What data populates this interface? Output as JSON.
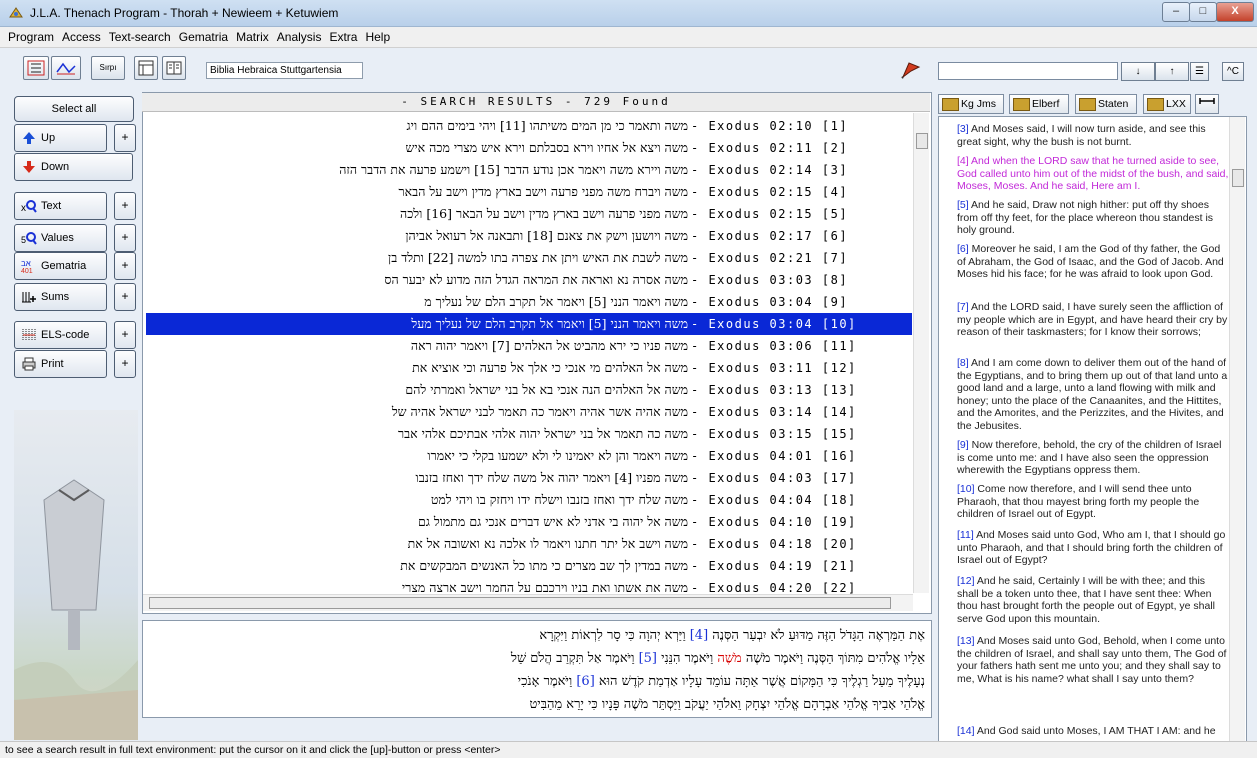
{
  "window": {
    "title": "J.L.A. Thenach Program - Thorah + Newieem + Ketuwiem",
    "minimize": "–",
    "maximize": "□",
    "close": "X"
  },
  "menu": [
    "Program",
    "Access",
    "Text-search",
    "Gematria",
    "Matrix",
    "Analysis",
    "Extra",
    "Help"
  ],
  "toolbar": {
    "bible": "Biblia Hebraica Stuttgartensia",
    "btn3": "Sırpı"
  },
  "right_toolbar": {
    "find_down": "↓",
    "find_up": "↑",
    "list_icon": "☰",
    "config": "^C"
  },
  "left": {
    "select_all": "Select all",
    "up": "Up",
    "down": "Down",
    "text": "Text",
    "values": "Values",
    "gematria": "Gematria",
    "sums": "Sums",
    "els": "ELS-code",
    "print": "Print",
    "plus": "+"
  },
  "results": {
    "title": "- SEARCH RESULTS - 729 Found",
    "rows": [
      {
        "heb": "משה ותאמר כי מן המים משיתהו [11] ויהי בימים ההם ויג",
        "ref": "- Exodus 02:10 [1]"
      },
      {
        "heb": "משה ויצא אל אחיו וירא בסבלתם וירא איש מצרי מכה איש",
        "ref": "- Exodus 02:11 [2]"
      },
      {
        "heb": "משה ויירא משה ויאמר אכן נודע הדבר [15] וישמע פרעה את הדבר הזה",
        "ref": "- Exodus 02:14 [3]"
      },
      {
        "heb": "משה ויברח משה מפני פרעה וישב בארץ מדין וישב על הבאר",
        "ref": "- Exodus 02:15 [4]"
      },
      {
        "heb": "משה מפני פרעה וישב בארץ מדין וישב על הבאר [16] ולכה",
        "ref": "- Exodus 02:15 [5]"
      },
      {
        "heb": "משה ויושען וישק את צאנם [18] ותבאנה אל רעואל אביהן",
        "ref": "- Exodus 02:17 [6]"
      },
      {
        "heb": "משה לשבת את האיש ויתן את צפרה בתו למשה [22] ותלד בן",
        "ref": "- Exodus 02:21 [7]"
      },
      {
        "heb": "משה אסרה נא ואראה את המראה הגדל הזה מדוע לא יבער הס",
        "ref": "- Exodus 03:03 [8]"
      },
      {
        "heb": "משה ויאמר הנני [5] ויאמר אל תקרב הלם של נעליך מ",
        "ref": "- Exodus 03:04 [9]"
      },
      {
        "heb": "משה ויאמר הנני [5] ויאמר אל תקרב הלם של נעליך מעל",
        "ref": "- Exodus 03:04 [10]"
      },
      {
        "heb": "משה פניו כי ירא מהביט אל האלהים [7] ויאמר יהוה ראה",
        "ref": "- Exodus 03:06 [11]"
      },
      {
        "heb": "משה אל האלהים מי אנכי כי אלך אל פרעה וכי אוציא את",
        "ref": "- Exodus 03:11 [12]"
      },
      {
        "heb": "משה אל האלהים הנה אנכי בא אל בני ישראל ואמרתי להם",
        "ref": "- Exodus 03:13 [13]"
      },
      {
        "heb": "משה אהיה אשר אהיה ויאמר כה תאמר לבני ישראל אהיה של",
        "ref": "- Exodus 03:14 [14]"
      },
      {
        "heb": "משה כה תאמר אל בני ישראל יהוה אלהי אבתיכם אלהי אבר",
        "ref": "- Exodus 03:15 [15]"
      },
      {
        "heb": "משה ויאמר והן לא יאמינו לי ולא ישמעו בקלי כי יאמרו",
        "ref": "- Exodus 04:01 [16]"
      },
      {
        "heb": "משה מפניו [4] ויאמר יהוה אל משה שלח ידך ואחז בזנבו",
        "ref": "- Exodus 04:03 [17]"
      },
      {
        "heb": "משה שלח ידך ואחז בזנבו וישלח ידו ויחזק בו ויהי למט",
        "ref": "- Exodus 04:04 [18]"
      },
      {
        "heb": "משה אל יהוה בי אדני לא איש דברים אנכי גם מתמול גם",
        "ref": "- Exodus 04:10 [19]"
      },
      {
        "heb": "משה וישב אל יתר חתנו ויאמר לו אלכה נא ואשובה אל את",
        "ref": "- Exodus 04:18 [20]"
      },
      {
        "heb": "משה במדין לך שב מצרים כי מתו כל האנשים המבקשים את",
        "ref": "- Exodus 04:19 [21]"
      },
      {
        "heb": "משה את אשתו ואת בניו וירכבם על החמר וישב ארצה מצרי",
        "ref": "- Exodus 04:20 [22]"
      }
    ]
  },
  "fulltext": {
    "line1": {
      "a": "אֶת הַמַּרְאֶה הַגָּדֹל הַזֶּה מַדּוּעַ לֹא יִבְעַר הַסְּנֶה ",
      "n": "[4]",
      "b": " וַיַּרְא יְהוָה כִּי סָר לִרְאוֹת וַיִּקְרָא"
    },
    "line2": {
      "a": "אֵלָיו אֱלֹהִים מִתּוֹךְ הַסְּנֶה וַיֹּאמֶר מֹשֶׁה ",
      "r": "מֹשֶׁה",
      "b": " וַיֹּאמֶר הִנֵּנִי ",
      "n": "[5]",
      "c": " וַיֹּאמֶר אַל תִּקְרַב הֲלֹם שַׁל"
    },
    "line3": {
      "a": "נְעָלֶיךָ מֵעַל רַגְלֶיךָ כִּי הַמָּקוֹם אֲשֶׁר אַתָּה עוֹמֵד עָלָיו אַדְמַת קֹדֶשׁ הוּא ",
      "n": "[6]",
      "b": " וַיֹּאמֶר אָנֹכִי"
    },
    "line4": {
      "a": "אֱלֹהֵי אָבִיךָ אֱלֹהֵי אַבְרָהָם אֱלֹהֵי יִצְחָק וֵאלֹהֵי יַעֲקֹב וַיַּסְתֵּר מֹשֶׁה פָּנָיו כִּי יָרֵא מֵהַבִּיט"
    }
  },
  "tabs": [
    "Kg Jms",
    "Elberf",
    "Staten",
    "LXX"
  ],
  "verses": [
    {
      "n": "[3]",
      "t": " And Moses said, I will now turn aside, and see this great sight, why the bush is not burnt."
    },
    {
      "n": "[4]",
      "t": " And when the LORD saw that he turned aside to see, God called unto him out of the midst of the bush, and said, Moses, Moses. And he said, Here am I."
    },
    {
      "n": "[5]",
      "t": " And he said, Draw not nigh hither: put off thy shoes from off thy feet, for the place whereon thou standest is holy ground."
    },
    {
      "n": "[6]",
      "t": " Moreover he said, I am the God of thy father, the God of Abraham, the God of Isaac, and the God of Jacob. And Moses hid his face; for he was afraid to look upon God."
    },
    {
      "n": "[7]",
      "t": " And the LORD said, I have surely seen the affliction of my people which are in Egypt, and have heard their cry by reason of their taskmasters; for I know their sorrows;"
    },
    {
      "n": "[8]",
      "t": " And I am come down to deliver them out of the hand of the Egyptians, and to bring them up out of that land unto a good land and a large, unto a land flowing with milk and honey; unto the place of the Canaanites, and the Hittites, and the Amorites, and the Perizzites, and the Hivites, and the Jebusites."
    },
    {
      "n": "[9]",
      "t": " Now therefore, behold, the cry of the children of Israel is come unto me: and I have also seen the oppression wherewith the Egyptians oppress them."
    },
    {
      "n": "[10]",
      "t": " Come now therefore, and I will send thee unto Pharaoh, that thou mayest bring forth my people the children of Israel out of Egypt."
    },
    {
      "n": "[11]",
      "t": " And Moses said unto God, Who am I, that I should go unto Pharaoh, and that I should bring forth the children of Israel out of Egypt?"
    },
    {
      "n": "[12]",
      "t": " And he said, Certainly I will be with thee; and this shall be a token unto thee, that I have sent thee: When thou hast brought forth the people out of Egypt, ye shall serve God upon this mountain."
    },
    {
      "n": "[13]",
      "t": " And Moses said unto God, Behold, when I come unto the children of Israel, and shall say unto them, The God of your fathers hath sent me unto you; and they shall say to me, What is his name? what shall I say unto them?"
    },
    {
      "n": "[14]",
      "t": " And God said unto Moses, I AM THAT I AM: and he"
    }
  ],
  "status": "to see a search result in full text environment: put the cursor on it and click the [up]-button or press <enter>"
}
